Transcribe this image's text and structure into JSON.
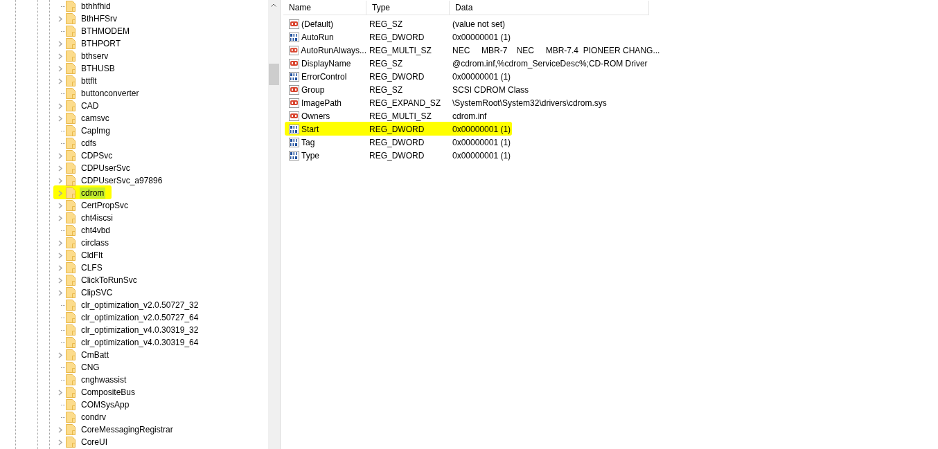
{
  "tree": {
    "items": [
      {
        "label": "bthhfhid",
        "expandable": false,
        "selected": false,
        "highlighted": false
      },
      {
        "label": "BthHFSrv",
        "expandable": true,
        "selected": false,
        "highlighted": false
      },
      {
        "label": "BTHMODEM",
        "expandable": false,
        "selected": false,
        "highlighted": false
      },
      {
        "label": "BTHPORT",
        "expandable": true,
        "selected": false,
        "highlighted": false
      },
      {
        "label": "bthserv",
        "expandable": true,
        "selected": false,
        "highlighted": false
      },
      {
        "label": "BTHUSB",
        "expandable": true,
        "selected": false,
        "highlighted": false
      },
      {
        "label": "bttflt",
        "expandable": true,
        "selected": false,
        "highlighted": false
      },
      {
        "label": "buttonconverter",
        "expandable": false,
        "selected": false,
        "highlighted": false
      },
      {
        "label": "CAD",
        "expandable": true,
        "selected": false,
        "highlighted": false
      },
      {
        "label": "camsvc",
        "expandable": true,
        "selected": false,
        "highlighted": false
      },
      {
        "label": "CapImg",
        "expandable": false,
        "selected": false,
        "highlighted": false
      },
      {
        "label": "cdfs",
        "expandable": false,
        "selected": false,
        "highlighted": false
      },
      {
        "label": "CDPSvc",
        "expandable": true,
        "selected": false,
        "highlighted": false
      },
      {
        "label": "CDPUserSvc",
        "expandable": true,
        "selected": false,
        "highlighted": false
      },
      {
        "label": "CDPUserSvc_a97896",
        "expandable": true,
        "selected": false,
        "highlighted": false
      },
      {
        "label": "cdrom",
        "expandable": true,
        "selected": true,
        "highlighted": true
      },
      {
        "label": "CertPropSvc",
        "expandable": true,
        "selected": false,
        "highlighted": false
      },
      {
        "label": "cht4iscsi",
        "expandable": true,
        "selected": false,
        "highlighted": false
      },
      {
        "label": "cht4vbd",
        "expandable": false,
        "selected": false,
        "highlighted": false
      },
      {
        "label": "circlass",
        "expandable": true,
        "selected": false,
        "highlighted": false
      },
      {
        "label": "CldFlt",
        "expandable": true,
        "selected": false,
        "highlighted": false
      },
      {
        "label": "CLFS",
        "expandable": true,
        "selected": false,
        "highlighted": false
      },
      {
        "label": "ClickToRunSvc",
        "expandable": true,
        "selected": false,
        "highlighted": false
      },
      {
        "label": "ClipSVC",
        "expandable": true,
        "selected": false,
        "highlighted": false
      },
      {
        "label": "clr_optimization_v2.0.50727_32",
        "expandable": false,
        "selected": false,
        "highlighted": false
      },
      {
        "label": "clr_optimization_v2.0.50727_64",
        "expandable": false,
        "selected": false,
        "highlighted": false
      },
      {
        "label": "clr_optimization_v4.0.30319_32",
        "expandable": false,
        "selected": false,
        "highlighted": false
      },
      {
        "label": "clr_optimization_v4.0.30319_64",
        "expandable": false,
        "selected": false,
        "highlighted": false
      },
      {
        "label": "CmBatt",
        "expandable": true,
        "selected": false,
        "highlighted": false
      },
      {
        "label": "CNG",
        "expandable": false,
        "selected": false,
        "highlighted": false
      },
      {
        "label": "cnghwassist",
        "expandable": false,
        "selected": false,
        "highlighted": false
      },
      {
        "label": "CompositeBus",
        "expandable": true,
        "selected": false,
        "highlighted": false
      },
      {
        "label": "COMSysApp",
        "expandable": false,
        "selected": false,
        "highlighted": false
      },
      {
        "label": "condrv",
        "expandable": false,
        "selected": false,
        "highlighted": false
      },
      {
        "label": "CoreMessagingRegistrar",
        "expandable": true,
        "selected": false,
        "highlighted": false
      },
      {
        "label": "CoreUI",
        "expandable": true,
        "selected": false,
        "highlighted": false
      }
    ]
  },
  "values": {
    "columns": [
      "Name",
      "Type",
      "Data"
    ],
    "rows": [
      {
        "kind": "string",
        "name": "(Default)",
        "type": "REG_SZ",
        "data": "(value not set)",
        "highlighted": false
      },
      {
        "kind": "binary",
        "name": "AutoRun",
        "type": "REG_DWORD",
        "data": "0x00000001 (1)",
        "highlighted": false
      },
      {
        "kind": "string",
        "name": "AutoRunAlways...",
        "type": "REG_MULTI_SZ",
        "data": "NEC     MBR-7    NEC     MBR-7.4  PIONEER CHANG...",
        "highlighted": false
      },
      {
        "kind": "string",
        "name": "DisplayName",
        "type": "REG_SZ",
        "data": "@cdrom.inf,%cdrom_ServiceDesc%;CD-ROM Driver",
        "highlighted": false
      },
      {
        "kind": "binary",
        "name": "ErrorControl",
        "type": "REG_DWORD",
        "data": "0x00000001 (1)",
        "highlighted": false
      },
      {
        "kind": "string",
        "name": "Group",
        "type": "REG_SZ",
        "data": "SCSI CDROM Class",
        "highlighted": false
      },
      {
        "kind": "string",
        "name": "ImagePath",
        "type": "REG_EXPAND_SZ",
        "data": "\\SystemRoot\\System32\\drivers\\cdrom.sys",
        "highlighted": false
      },
      {
        "kind": "string",
        "name": "Owners",
        "type": "REG_MULTI_SZ",
        "data": "cdrom.inf",
        "highlighted": false
      },
      {
        "kind": "binary",
        "name": "Start",
        "type": "REG_DWORD",
        "data": "0x00000001 (1)",
        "highlighted": true
      },
      {
        "kind": "binary",
        "name": "Tag",
        "type": "REG_DWORD",
        "data": "0x00000001 (1)",
        "highlighted": false
      },
      {
        "kind": "binary",
        "name": "Type",
        "type": "REG_DWORD",
        "data": "0x00000001 (1)",
        "highlighted": false
      }
    ]
  }
}
